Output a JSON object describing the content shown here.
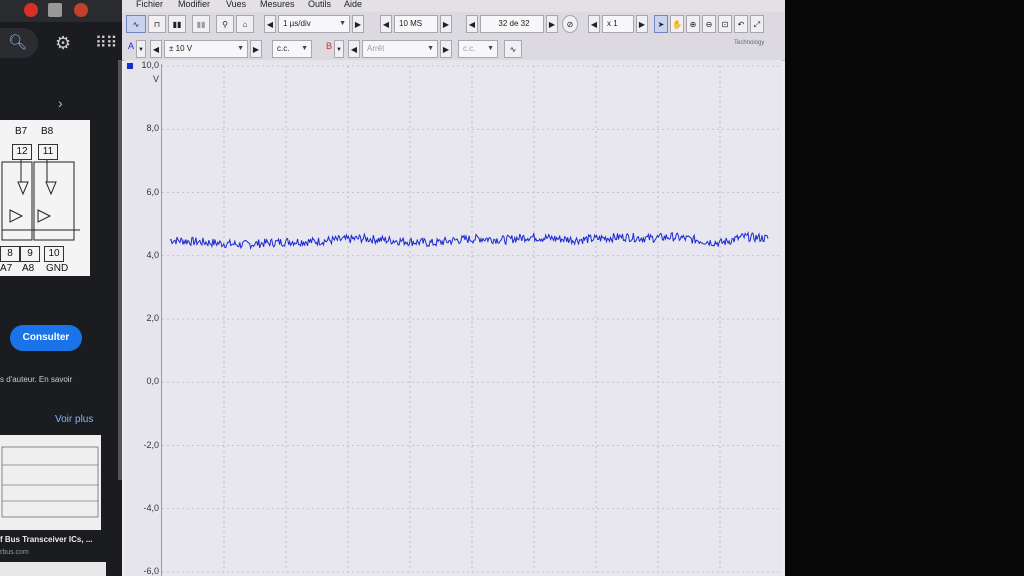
{
  "menu": {
    "fichier": "Fichier",
    "modifier": "Modifier",
    "vues": "Vues",
    "mesures": "Mesures",
    "outils": "Outils",
    "aide": "Aide"
  },
  "toolbar": {
    "timebase": "1 µs/div",
    "samples": "10 MS",
    "buffer": "32 de 32",
    "zoom": "x 1"
  },
  "channel_a": {
    "label": "A",
    "range": "± 10 V",
    "coupling": "c.c."
  },
  "channel_b": {
    "label": "B",
    "state": "Arrêt",
    "coupling": "c.c."
  },
  "brand": "Technology",
  "y_axis": {
    "unit": "V",
    "ticks": [
      "10,0",
      "8,0",
      "6,0",
      "4,0",
      "2,0",
      "0,0",
      "-2,0",
      "-4,0",
      "-6,0"
    ]
  },
  "browser": {
    "pins_top": [
      "B7",
      "B8"
    ],
    "pin_numbers": [
      "12",
      "11"
    ],
    "pins_bottom": [
      "A7",
      "A8",
      "GND"
    ],
    "pin_numbers_bottom": [
      "8",
      "9",
      "10"
    ],
    "consult_button": "Consulter",
    "copyright_text": "s d'auteur. En savoir",
    "see_more": "Voir plus",
    "result_caption": "f Bus Transceiver ICs, ...",
    "source": "rbus.com"
  },
  "colors": {
    "waveform": "#1a2ad0",
    "grid": "#b8b6c4"
  },
  "chart_data": {
    "type": "line",
    "title": "",
    "xlabel": "",
    "ylabel": "V",
    "ylim": [
      -6,
      10
    ],
    "x_divisions": 10,
    "series": [
      {
        "values": [
          4.5,
          4.45,
          4.4,
          4.35,
          4.4,
          4.45,
          4.45,
          4.5,
          4.55,
          4.5,
          4.45,
          4.4,
          4.5,
          4.55,
          4.5,
          4.6,
          4.55,
          4.5,
          4.55,
          4.6,
          4.55,
          4.6,
          4.5,
          4.4,
          4.6,
          4.55
        ]
      }
    ]
  }
}
